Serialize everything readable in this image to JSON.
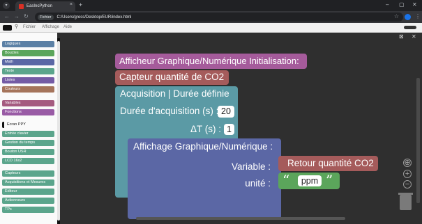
{
  "browser": {
    "tab_title": "EasIncPython",
    "tab_close": "×",
    "new_tab": "+",
    "back": "←",
    "forward": "→",
    "reload": "↻",
    "site_chip": "Fichier",
    "url": "C:/Users/gress/Desktop/EUR/index.html",
    "star": "☆",
    "kebab": "⋮",
    "win_min": "–",
    "win_max": "▢",
    "win_close": "✕",
    "colors": {
      "frame": "#202124",
      "toolbar": "#35363a"
    }
  },
  "app": {
    "menu": [
      "Fichier",
      "Affichage",
      "Aide"
    ],
    "pin_icon": "pin-icon"
  },
  "sidebar": {
    "categories": [
      {
        "label": "Logiques",
        "color": "#5b80a5"
      },
      {
        "label": "Boucles",
        "color": "#5ba55b"
      },
      {
        "label": "Math",
        "color": "#5b67a5"
      },
      {
        "label": "Texte",
        "color": "#5ba58c"
      },
      {
        "label": "Listes",
        "color": "#745ba5"
      },
      {
        "label": "Couleurs",
        "color": "#a5745b"
      },
      {
        "label": "Variables",
        "color": "#a55b80"
      },
      {
        "label": "Fonctions",
        "color": "#995ba5"
      },
      {
        "label": "Ecran PPY",
        "color": "#ffffff"
      },
      {
        "label": "Entrée clavier",
        "color": "#5ba58c"
      },
      {
        "label": "Gestion du temps",
        "color": "#5ba58c"
      },
      {
        "label": "Bouton USR",
        "color": "#5ba58c"
      },
      {
        "label": "LCD 16x2",
        "color": "#5ba58c"
      },
      {
        "label": "Capteurs",
        "color": "#5ba58c"
      },
      {
        "label": "Acquisitions et Mesures",
        "color": "#5ba58c"
      },
      {
        "label": "Editeur",
        "color": "#5ba58c"
      },
      {
        "label": "Actionneurs",
        "color": "#5ba58c"
      },
      {
        "label": "TPs",
        "color": "#5ba58c"
      }
    ]
  },
  "blocks": {
    "init_title": "Afficheur Graphique/Numérique Initialisation:",
    "capteur": "Capteur quantité de CO2",
    "acquisition": "Acquisition | Durée définie",
    "duree_label": "Durée d'acquisition (s) :",
    "duree_value": "20",
    "dt_label": "ΔT (s) :",
    "dt_value": "1",
    "affichage": "Affichage Graphique/Numérique :",
    "variable_label": "Variable :",
    "retour": "Retour quantité CO2",
    "unite_label": "unité :",
    "quote_open": "“",
    "quote_close": "”",
    "unit_value": "ppm",
    "colors": {
      "init": "#a55b9b",
      "capteur": "#a55b5b",
      "acquisition": "#5b9aa5",
      "affichage": "#5b67a5",
      "text": "#5ba55b"
    }
  },
  "controls": {
    "recenter": "⊕",
    "zoom_in": "+",
    "zoom_out": "−"
  }
}
